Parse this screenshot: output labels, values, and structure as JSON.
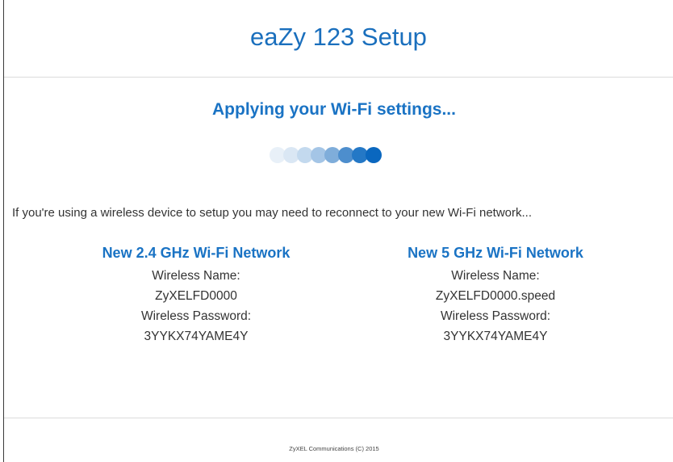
{
  "header": {
    "title": "eaZy 123 Setup"
  },
  "status": {
    "title": "Applying your Wi-Fi settings...",
    "progress_dots": [
      "#e8f0f8",
      "#dae7f4",
      "#c3d9ee",
      "#a4c5e6",
      "#7fadda",
      "#4d8ecd",
      "#2478c6",
      "#0a67bf"
    ]
  },
  "notice": "If you're using a wireless device to setup you may need to reconnect to your new Wi-Fi network...",
  "networks": {
    "band_24": {
      "title": "New 2.4 GHz Wi-Fi Network",
      "name_label": "Wireless Name:",
      "name_value": "ZyXELFD0000",
      "password_label": "Wireless Password:",
      "password_value": "3YYKX74YAME4Y"
    },
    "band_5": {
      "title": "New 5 GHz Wi-Fi Network",
      "name_label": "Wireless Name:",
      "name_value": "ZyXELFD0000.speed",
      "password_label": "Wireless Password:",
      "password_value": "3YYKX74YAME4Y"
    }
  },
  "footer": {
    "copyright": "ZyXEL Communications (C) 2015"
  }
}
